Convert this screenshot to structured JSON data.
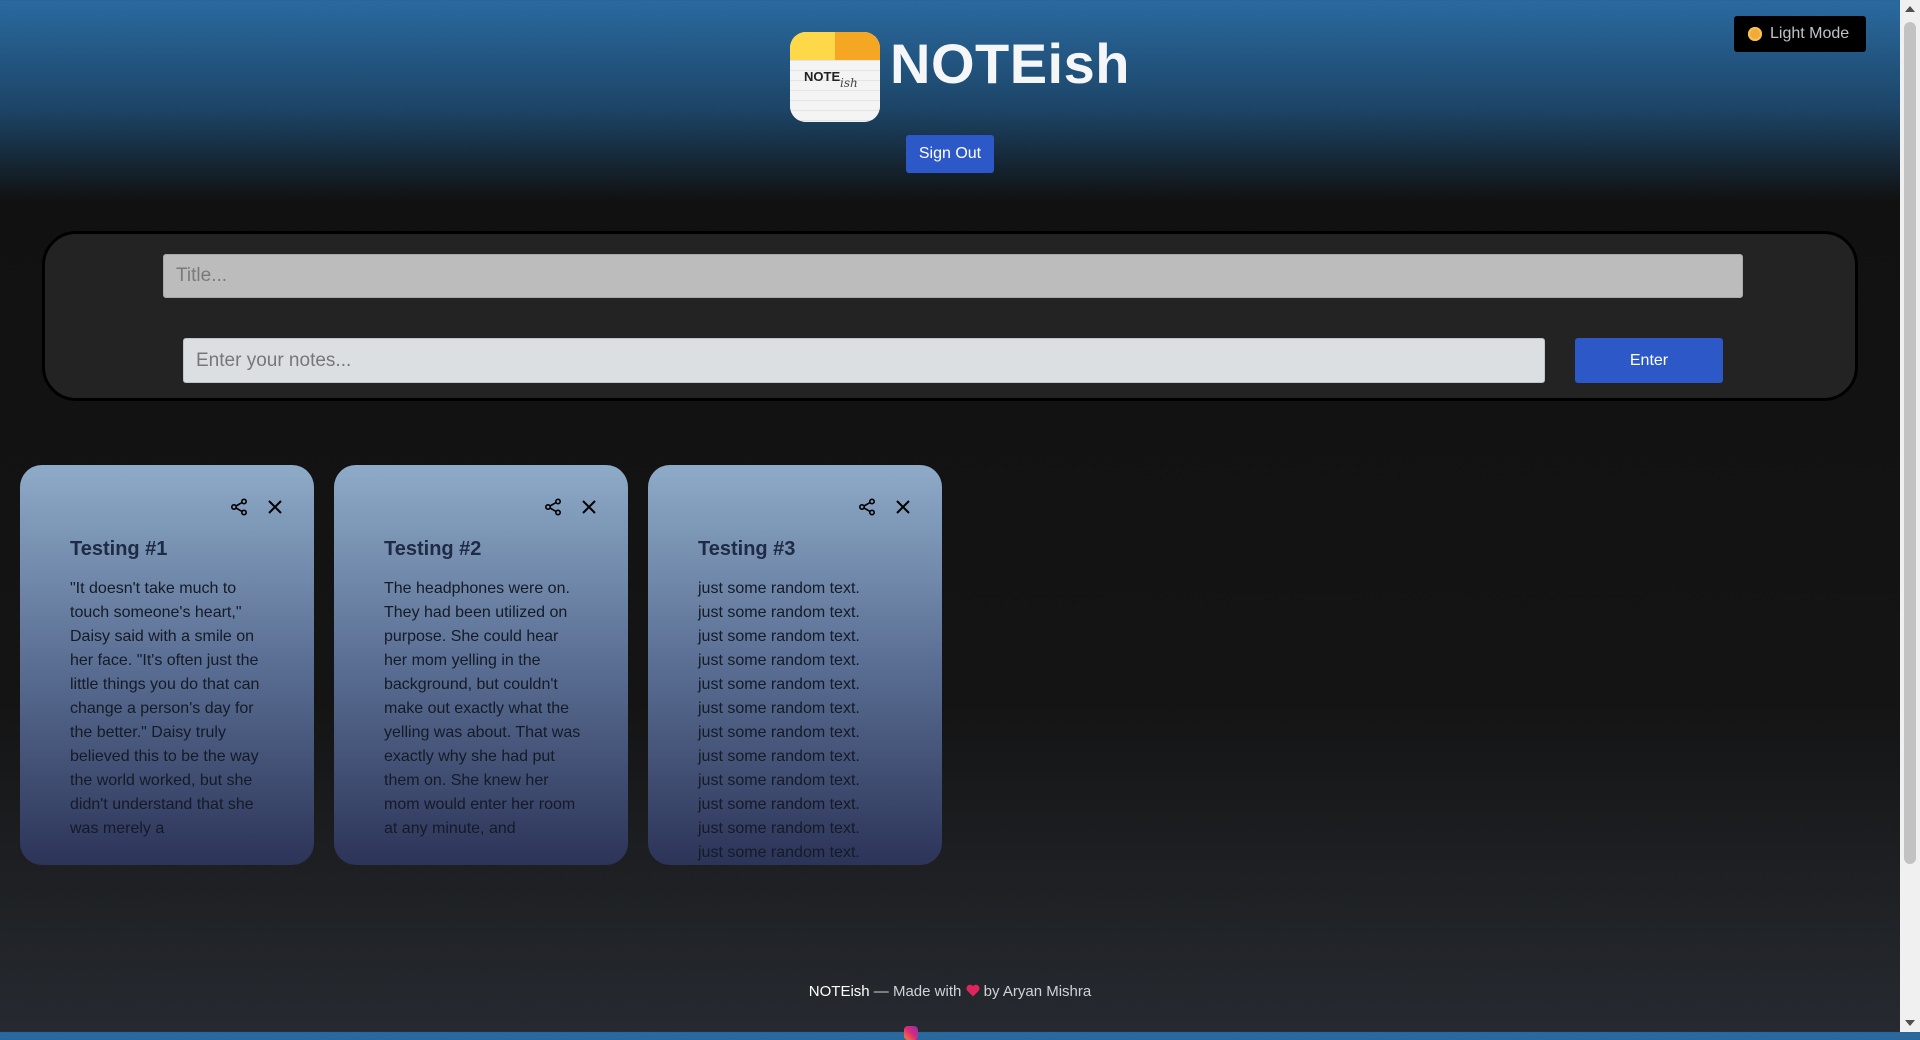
{
  "header": {
    "logo_text": "NOTE",
    "logo_script": "ish",
    "app_title": "NOTEish",
    "sign_out_label": "Sign Out",
    "theme_toggle_label": "Light Mode"
  },
  "form": {
    "title_placeholder": "Title...",
    "notes_placeholder": "Enter your notes...",
    "enter_label": "Enter"
  },
  "notes": [
    {
      "title": "Testing #1",
      "body": "\"It doesn't take much to touch someone's heart,\" Daisy said with a smile on her face. \"It's often just the little things you do that can change a person's day for the better.\" Daisy truly believed this to be the way the world worked, but she didn't understand that she was merely a"
    },
    {
      "title": "Testing #2",
      "body": "The headphones were on. They had been utilized on purpose. She could hear her mom yelling in the background, but couldn't make out exactly what the yelling was about. That was exactly why she had put them on. She knew her mom would enter her room at any minute, and"
    },
    {
      "title": "Testing #3",
      "body": "just some random text.\njust some random text.\njust some random text.\njust some random text.\njust some random text.\njust some random text.\njust some random text.\njust some random text.\njust some random text.\njust some random text.\njust some random text.\njust some random text."
    }
  ],
  "footer": {
    "brand": "NOTEish",
    "made_with": " — Made with ",
    "by": " by Aryan Mishra"
  },
  "colors": {
    "accent": "#2c58c8",
    "heart": "#e0245e"
  }
}
